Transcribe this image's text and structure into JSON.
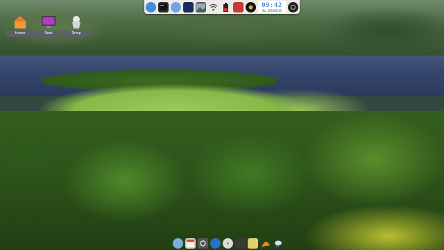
{
  "desktop": {
    "icons": [
      {
        "label": "Home",
        "icon": "home-folder-icon"
      },
      {
        "label": "Root",
        "icon": "root-monitor-icon"
      },
      {
        "label": "Temp",
        "icon": "temp-trash-icon"
      }
    ]
  },
  "top_dock": {
    "items": [
      "menu-icon",
      "terminal-icon",
      "browser-icon",
      "screenshot-icon",
      "image-viewer-icon",
      "wifi-icon",
      "battery-icon",
      "volume-icon",
      "media-player-icon",
      "power-icon"
    ],
    "clock": {
      "time": "09:42",
      "date": "Sa, 2019/6/15"
    }
  },
  "bottom_dock": {
    "items": [
      "disk-icon",
      "file-manager-icon",
      "settings-icon",
      "web-browser-icon",
      "cd-icon",
      "trash-icon",
      "notes-icon",
      "snail-icon",
      "weather-icon"
    ]
  },
  "colors": {
    "clock_text": "#1f6fd6",
    "dock_bg": "#eceae6",
    "label_bg": "#5b6069"
  }
}
